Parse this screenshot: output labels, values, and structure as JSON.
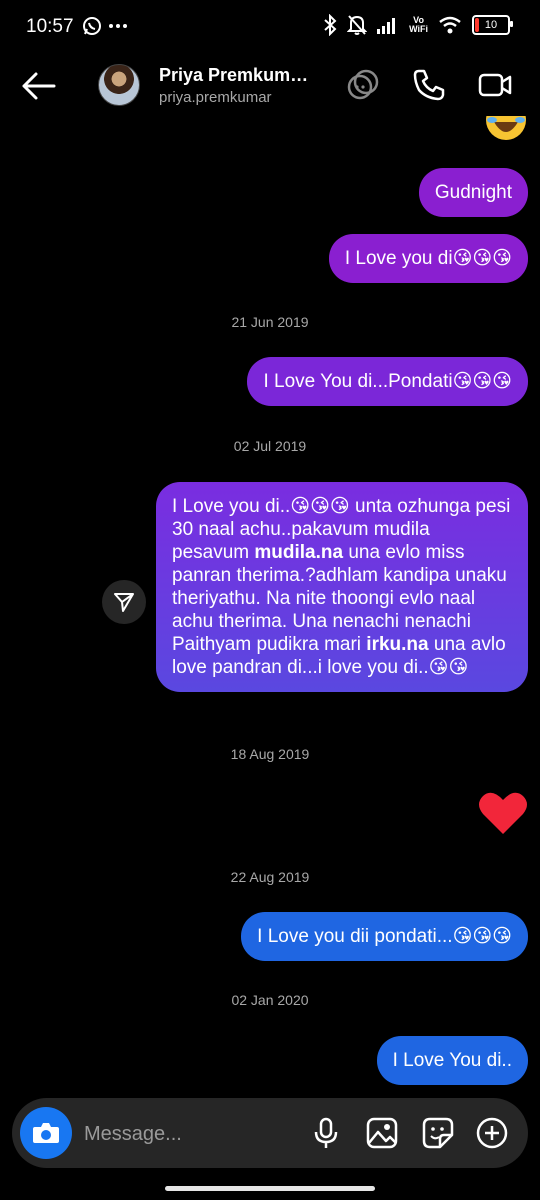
{
  "status_bar": {
    "time": "10:57",
    "battery": "10",
    "vowifi_top": "Vo",
    "vowifi_bottom": "WiFi"
  },
  "header": {
    "name": "Priya Premkum…",
    "username": "priya.premkumar"
  },
  "messages": [
    {
      "text": "Gudnight"
    },
    {
      "text": "I Love you di😘😘😘"
    },
    {
      "text": "I Love You di...Pondati😘😘😘"
    },
    {
      "pre": "I Love you di..😘😘😘 unta ozhunga pesi 30 naal achu..pakavum mudila pesavum ",
      "bold1": "mudila.na",
      "mid": " una evlo miss panran therima.?adhlam kandipa unaku theriyathu. Na nite thoongi evlo naal achu therima. Una nenachi nenachi Paithyam pudikra mari ",
      "bold2": "irku.na",
      "post": " una avlo love pandran di...i love you di..😘😘"
    },
    {
      "text": "I Love you dii pondati...😘😘😘"
    },
    {
      "text": "I Love You di.."
    }
  ],
  "dates": [
    "21 Jun 2019",
    "02 Jul 2019",
    "18 Aug 2019",
    "22 Aug 2019",
    "02 Jan 2020"
  ],
  "composer": {
    "placeholder": "Message..."
  },
  "colors": {
    "purple": "#8a1fd0",
    "blue": "#1f66e2",
    "heart": "#f2263a",
    "camera": "#1877f2"
  }
}
